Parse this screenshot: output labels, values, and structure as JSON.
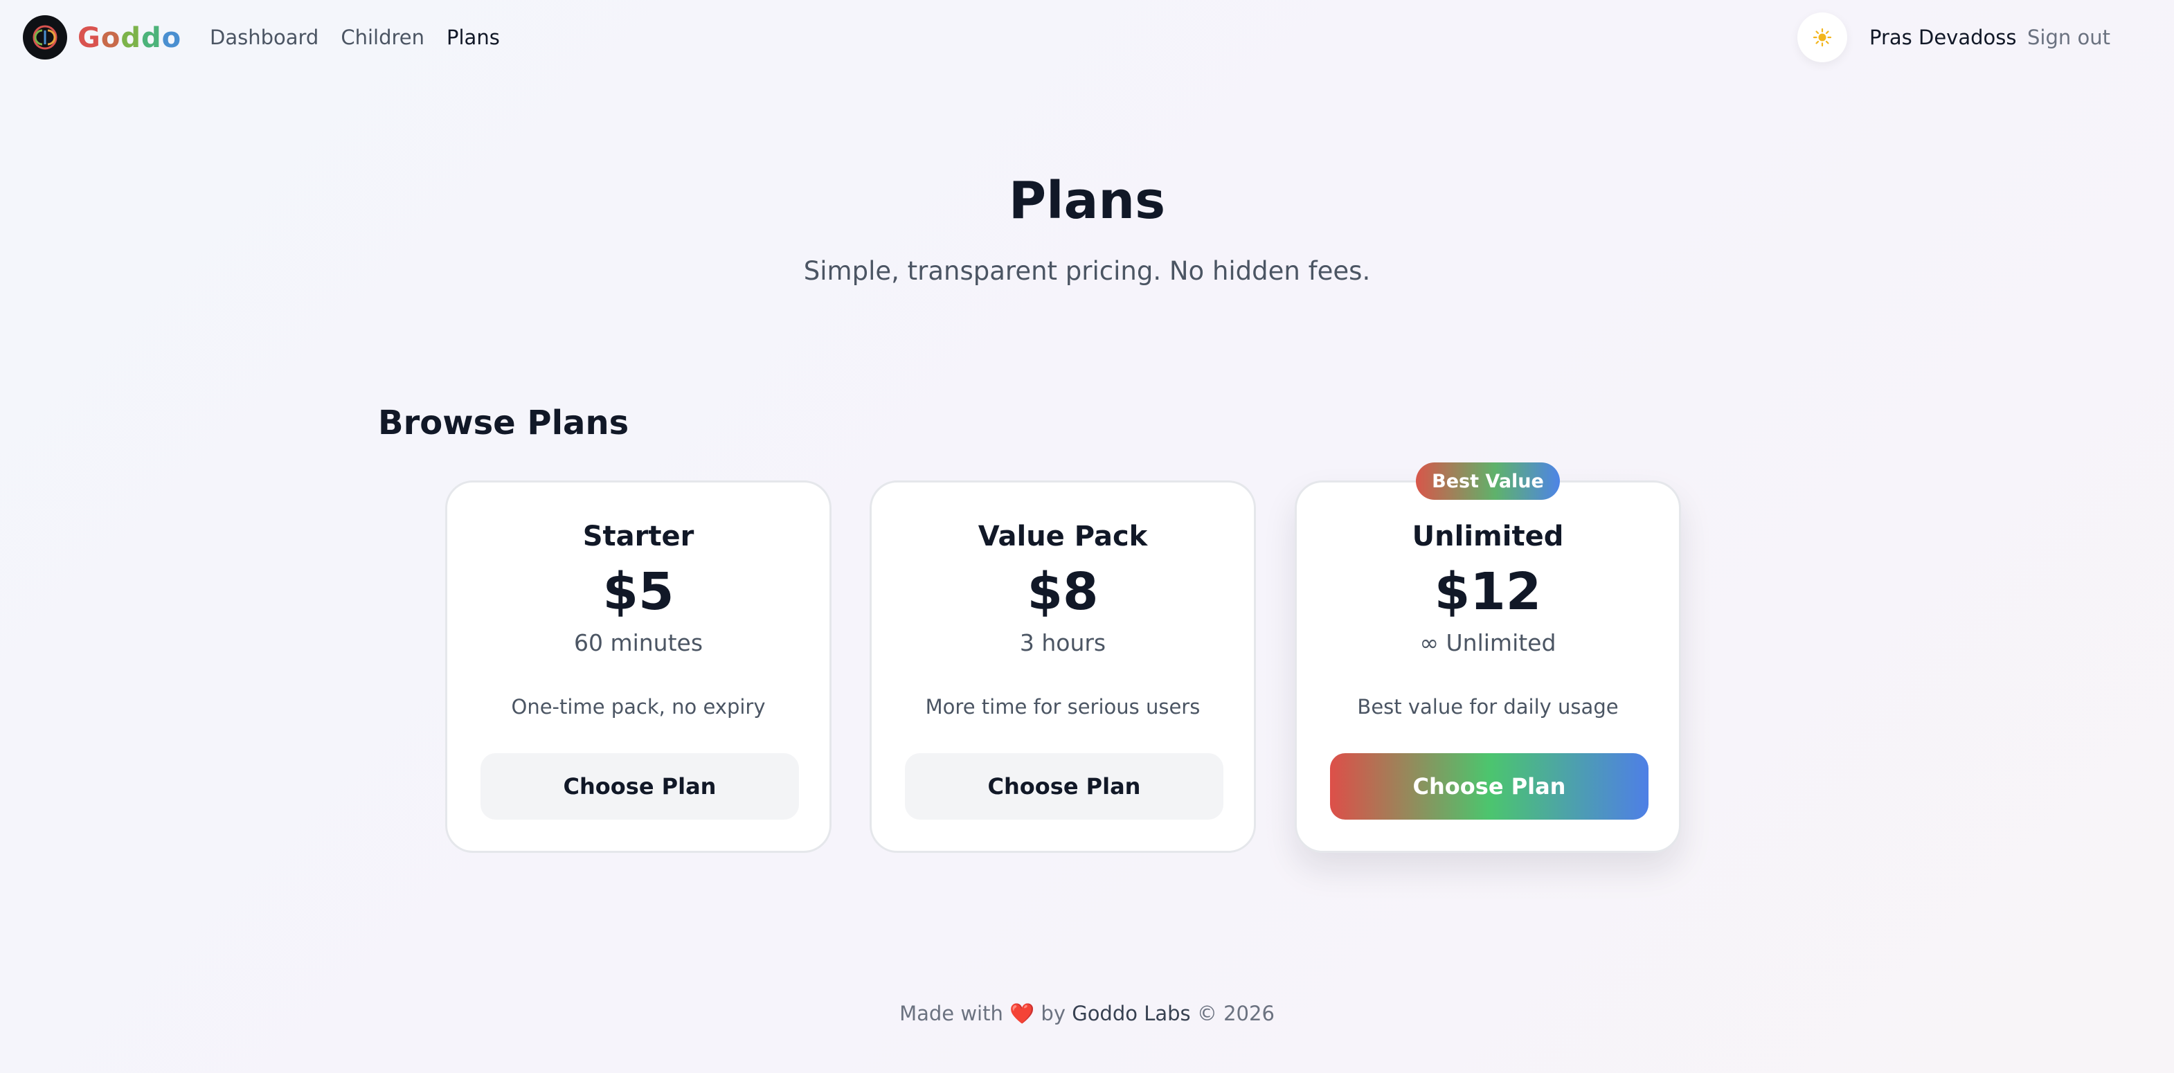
{
  "header": {
    "brand": [
      "G",
      "o",
      "d",
      "d",
      "o"
    ],
    "nav": [
      {
        "label": "Dashboard"
      },
      {
        "label": "Children"
      },
      {
        "label": "Plans"
      }
    ],
    "theme_icon": "sun-icon",
    "user_name": "Pras Devadoss",
    "sign_out": "Sign out"
  },
  "hero": {
    "title": "Plans",
    "subtitle": "Simple, transparent pricing. No hidden fees."
  },
  "section_title": "Browse Plans",
  "plans": [
    {
      "name": "Starter",
      "price": "$5",
      "amount": "60 minutes",
      "description": "One-time pack, no expiry",
      "button": "Choose Plan"
    },
    {
      "name": "Value Pack",
      "price": "$8",
      "amount": "3 hours",
      "description": "More time for serious users",
      "button": "Choose Plan"
    },
    {
      "name": "Unlimited",
      "price": "$12",
      "amount": "∞ Unlimited",
      "description": "Best value for daily usage",
      "button": "Choose Plan",
      "badge": "Best Value"
    }
  ],
  "footer": {
    "made_with": "Made with",
    "heart": "❤️",
    "by": "by",
    "company": "Goddo Labs",
    "copyright": "© 2026"
  },
  "colors": {
    "accent_red": "#dd4f49",
    "accent_green": "#4cc56e",
    "accent_blue": "#4e7fe6",
    "text_dark": "#111827",
    "text_muted": "#4b5563"
  }
}
